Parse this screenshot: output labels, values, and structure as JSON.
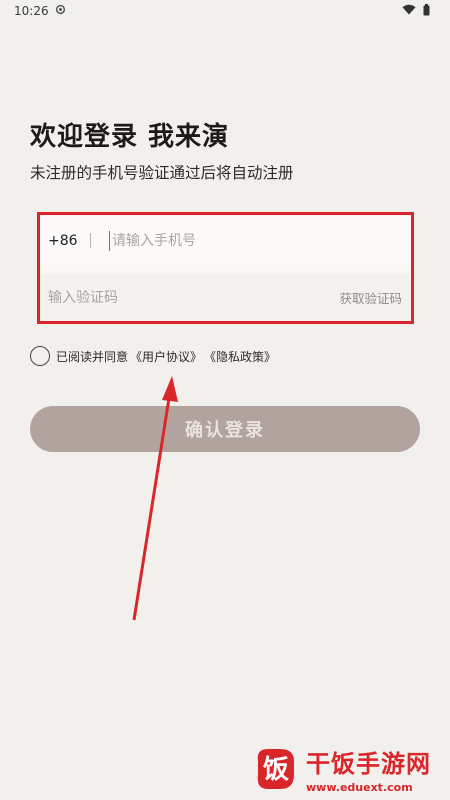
{
  "status_bar": {
    "time": "10:26"
  },
  "header": {
    "title": "欢迎登录 我来演",
    "subtitle": "未注册的手机号验证通过后将自动注册"
  },
  "form": {
    "country_code": "+86",
    "phone_placeholder": "请输入手机号",
    "phone_value": "",
    "code_placeholder": "输入验证码",
    "code_value": "",
    "get_code_label": "获取验证码"
  },
  "agreement": {
    "prefix": "已阅读并同意",
    "user_agreement": "《用户协议》",
    "privacy_policy": "《隐私政策》",
    "checked": false
  },
  "login_button": {
    "label": "确认登录"
  },
  "watermark": {
    "brand": "干饭手游网",
    "url": "www.eduext.com"
  },
  "colors": {
    "background": "#f2f0ec",
    "highlight": "#d9262b",
    "button": "#b3a39e",
    "caret": "#4a78c2"
  }
}
